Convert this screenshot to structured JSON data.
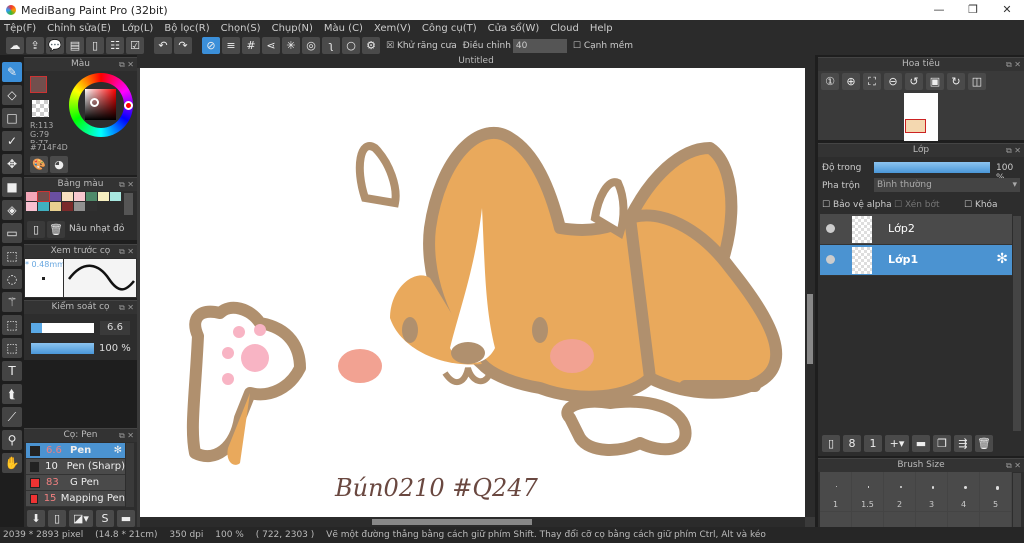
{
  "app": {
    "title": "MediBang Paint Pro (32bit)",
    "win_min": "—",
    "win_max": "❐",
    "win_close": "✕"
  },
  "menu": [
    "Tệp(F)",
    "Chỉnh sửa(E)",
    "Lớp(L)",
    "Bộ lọc(R)",
    "Chọn(S)",
    "Chụp(N)",
    "Màu (C)",
    "Xem(V)",
    "Công cụ(T)",
    "Cửa sổ(W)",
    "Cloud",
    "Help"
  ],
  "toolbar": {
    "antialias_label": "Khử răng cưa",
    "adjust_label": "Điều chỉnh",
    "adjust_value": "40",
    "smooth_label": "Cạnh mềm"
  },
  "color_panel": {
    "title": "Màu",
    "r": "R:113",
    "g": "G:79",
    "b": "B:77",
    "hex": "#714F4D",
    "fg": "#714F4D"
  },
  "palette_panel": {
    "title": "Bảng màu",
    "selected_name": "Nâu nhạt đỏ",
    "swatches": [
      "#f4a7b9",
      "#714f4d",
      "#6a4fa0",
      "#f7dfc0",
      "#f8c8d0",
      "#4f8a6a",
      "#f7efc0",
      "#a8e8e0",
      "#f8c0d0",
      "#40b0c0",
      "#e8d090",
      "#7a2a2a",
      "#909090",
      "#303030"
    ]
  },
  "brush_preview": {
    "title": "Xem trước cọ",
    "size": "* 0.48mm"
  },
  "brush_control": {
    "title": "Kiểm soát cọ",
    "size_value": "6.6",
    "size_fraction": 0.17,
    "opacity_value": "100 %",
    "opacity_fraction": 1.0
  },
  "brush_list": {
    "title": "Cọ: Pen",
    "items": [
      {
        "size": "6.6",
        "name": "Pen",
        "color": "#222222",
        "selected": true
      },
      {
        "size": "10",
        "name": "Pen (Sharp)",
        "color": "#222222",
        "selected": false
      },
      {
        "size": "83",
        "name": "G Pen",
        "color": "#ee3333",
        "selected": false
      },
      {
        "size": "15",
        "name": "Mapping Pen",
        "color": "#ee3333",
        "selected": false
      }
    ]
  },
  "document": {
    "title": "Untitled",
    "signature": "Bún0210 #Q247"
  },
  "navigator": {
    "title": "Hoa tiêu"
  },
  "layer_panel": {
    "title": "Lớp",
    "opacity_label": "Độ trong",
    "opacity_value": "100 %",
    "opacity_fraction": 1.0,
    "blend_label": "Pha trộn",
    "blend_value": "Bình thường",
    "protect_alpha": "Bảo vệ alpha",
    "clipping": "Xén bớt",
    "lock": "Khóa",
    "layers": [
      {
        "name": "Lớp2",
        "selected": false
      },
      {
        "name": "Lớp1",
        "selected": true
      }
    ]
  },
  "brush_size_panel": {
    "title": "Brush Size",
    "sizes": [
      "1",
      "1.5",
      "2",
      "3",
      "4",
      "5"
    ]
  },
  "status": {
    "pixels": "2039 * 2893 pixel",
    "cm": "(14.8 * 21cm)",
    "dpi": "350 dpi",
    "zoom": "100 %",
    "coords": "( 722, 2303 )",
    "hint": "Vẽ một đường thẳng bằng cách giữ phím Shift. Thay đổi cỡ cọ bằng cách giữ phím Ctrl, Alt và kéo"
  }
}
